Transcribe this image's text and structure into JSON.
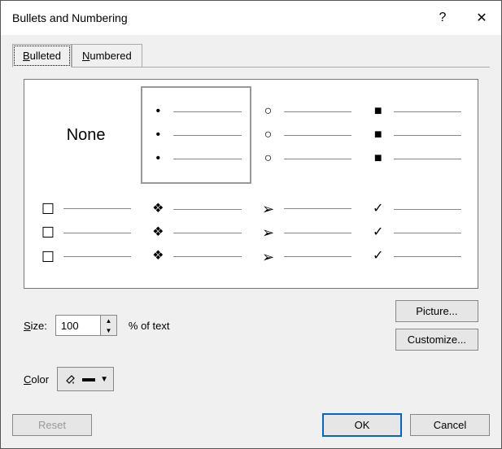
{
  "title": "Bullets and Numbering",
  "help_glyph": "?",
  "close_glyph": "✕",
  "tabs": {
    "bulleted": "Bulleted",
    "numbered": "Numbered"
  },
  "grid": {
    "none": "None",
    "items": [
      {
        "name": "bullet-none",
        "glyph": "",
        "none": true,
        "selected": false
      },
      {
        "name": "bullet-disc",
        "glyph": "•",
        "selected": true
      },
      {
        "name": "bullet-circle",
        "glyph": "○",
        "selected": false
      },
      {
        "name": "bullet-square-sm",
        "glyph": "■",
        "selected": false
      },
      {
        "name": "bullet-square-lg",
        "glyph": "☐",
        "selected": false
      },
      {
        "name": "bullet-diamond",
        "glyph": "❖",
        "selected": false
      },
      {
        "name": "bullet-arrow",
        "glyph": "➢",
        "selected": false
      },
      {
        "name": "bullet-check",
        "glyph": "✓",
        "selected": false
      }
    ]
  },
  "size": {
    "label": "Size:",
    "value": "100",
    "suffix": "% of text"
  },
  "color": {
    "label": "Color"
  },
  "buttons": {
    "picture": "Picture...",
    "customize": "Customize...",
    "reset": "Reset",
    "ok": "OK",
    "cancel": "Cancel"
  }
}
